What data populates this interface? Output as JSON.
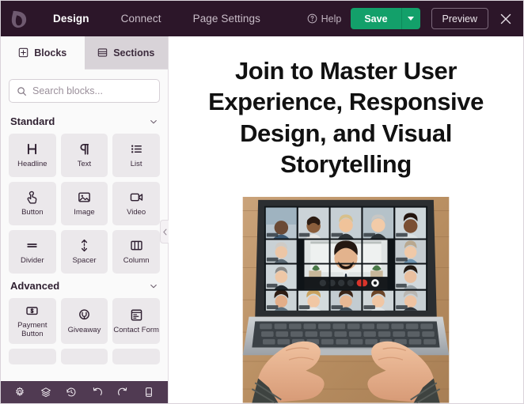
{
  "topbar": {
    "logo_icon": "leaf-logo-icon",
    "nav": [
      {
        "label": "Design",
        "active": true
      },
      {
        "label": "Connect",
        "active": false
      },
      {
        "label": "Page Settings",
        "active": false
      }
    ],
    "help_label": "Help",
    "help_icon": "question-circle-icon",
    "save_label": "Save",
    "save_caret_icon": "caret-down-icon",
    "preview_label": "Preview",
    "close_icon": "close-icon",
    "colors": {
      "bar_background": "#2c1629",
      "save_green": "#13a06a",
      "nav_inactive": "#c9bdc8",
      "nav_active": "#ffffff"
    }
  },
  "sidebar": {
    "tabs": [
      {
        "label": "Blocks",
        "icon": "blocks-grid-icon",
        "active": true
      },
      {
        "label": "Sections",
        "icon": "sections-rows-icon",
        "active": false
      }
    ],
    "search": {
      "placeholder": "Search blocks...",
      "value": "",
      "icon": "search-icon"
    },
    "groups": [
      {
        "title": "Standard",
        "chevron_icon": "chevron-down-icon",
        "expanded": true,
        "tiles": [
          {
            "label": "Headline",
            "icon": "headline-h-icon"
          },
          {
            "label": "Text",
            "icon": "paragraph-pilcrow-icon"
          },
          {
            "label": "List",
            "icon": "bulleted-list-icon"
          },
          {
            "label": "Button",
            "icon": "button-click-hand-icon"
          },
          {
            "label": "Image",
            "icon": "image-picture-icon"
          },
          {
            "label": "Video",
            "icon": "video-camera-icon"
          },
          {
            "label": "Divider",
            "icon": "divider-lines-icon"
          },
          {
            "label": "Spacer",
            "icon": "spacer-arrows-icon"
          },
          {
            "label": "Column",
            "icon": "columns-icon"
          }
        ]
      },
      {
        "title": "Advanced",
        "chevron_icon": "chevron-down-icon",
        "expanded": true,
        "tiles": [
          {
            "label": "Payment Button",
            "icon": "payment-dollar-icon"
          },
          {
            "label": "Giveaway",
            "icon": "giveaway-trophy-icon"
          },
          {
            "label": "Contact Form",
            "icon": "contact-form-clipboard-icon"
          }
        ]
      }
    ],
    "collapse_handle_icon": "chevron-left-icon",
    "footer_icons": [
      "settings-gear-icon",
      "layers-icon",
      "revision-history-icon",
      "undo-icon",
      "redo-icon",
      "device-preview-icon"
    ],
    "colors": {
      "panel_background": "#fafafa",
      "tile_background": "#ebe8eb",
      "footer_background": "#503a52",
      "inactive_tab_background": "#d8d3d8"
    }
  },
  "canvas": {
    "hero_title": "Join to Master User Experience, Responsive Design, and Visual Storytelling",
    "hero_image_alt": "Laptop on a wooden desk showing a video conference grid of twelve participants, with two hands typing on the keyboard",
    "background": "#ffffff"
  }
}
